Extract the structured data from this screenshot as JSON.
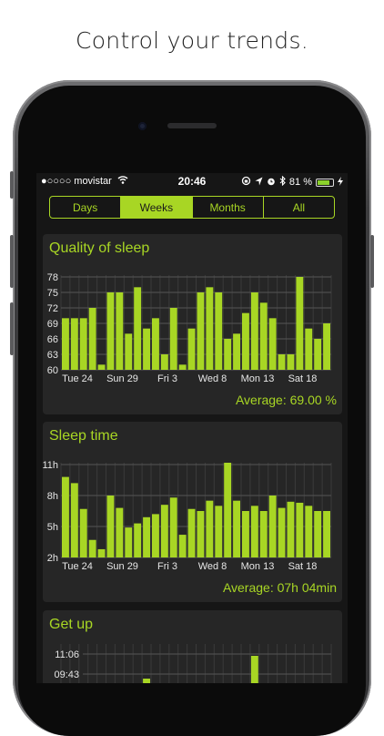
{
  "promo": {
    "headline": "Control your trends."
  },
  "status_bar": {
    "carrier": "●○○○○ movistar",
    "time": "20:46",
    "battery": "81 %",
    "battery_level": 0.81,
    "icons": [
      "wifi-icon",
      "lock-rotation-icon",
      "location-icon",
      "alarm-icon",
      "bluetooth-icon",
      "charging-icon"
    ]
  },
  "tabs": [
    {
      "label": "Days",
      "active": false
    },
    {
      "label": "Weeks",
      "active": true
    },
    {
      "label": "Months",
      "active": false
    },
    {
      "label": "All",
      "active": false
    }
  ],
  "colors": {
    "accent": "#a8d624",
    "card": "#262626",
    "background": "#161616"
  },
  "cards": {
    "quality": {
      "title": "Quality of sleep",
      "average": "Average: 69.00 %"
    },
    "sleep_time": {
      "title": "Sleep time",
      "average": "Average: 07h 04min"
    },
    "get_up": {
      "title": "Get up"
    }
  },
  "chart_data": [
    {
      "type": "bar",
      "title": "Quality of sleep",
      "yticks": [
        "78",
        "75",
        "72",
        "69",
        "66",
        "63",
        "60"
      ],
      "ylim": [
        60,
        78
      ],
      "xticks": [
        "Tue 24",
        "Sun 29",
        "Fri 3",
        "Wed 8",
        "Mon 13",
        "Sat 18"
      ],
      "values": [
        70,
        70,
        70,
        72,
        61,
        75,
        75,
        67,
        76,
        68,
        70,
        63,
        72,
        61,
        68,
        75,
        76,
        75,
        66,
        67,
        71,
        75,
        73,
        70,
        63,
        63,
        78,
        68,
        66,
        69
      ],
      "grid": true
    },
    {
      "type": "bar",
      "title": "Sleep time",
      "yticks": [
        "11h",
        "8h",
        "5h",
        "2h"
      ],
      "ylim": [
        2,
        11
      ],
      "xticks": [
        "Tue 24",
        "Sun 29",
        "Fri 3",
        "Wed 8",
        "Mon 13",
        "Sat 18"
      ],
      "values": [
        9.8,
        9.2,
        6.7,
        3.7,
        2.8,
        8.0,
        6.8,
        4.9,
        5.3,
        5.9,
        6.2,
        7.1,
        7.8,
        4.2,
        6.7,
        6.5,
        7.5,
        7.0,
        12.0,
        7.5,
        6.5,
        7.0,
        6.5,
        8.0,
        6.8,
        7.4,
        7.3,
        7.0,
        6.5,
        6.5
      ],
      "grid": true
    },
    {
      "type": "bar",
      "title": "Get up",
      "yticks": [
        "11:06",
        "09:43"
      ],
      "visible_values": [
        9.4,
        10.6
      ]
    }
  ]
}
